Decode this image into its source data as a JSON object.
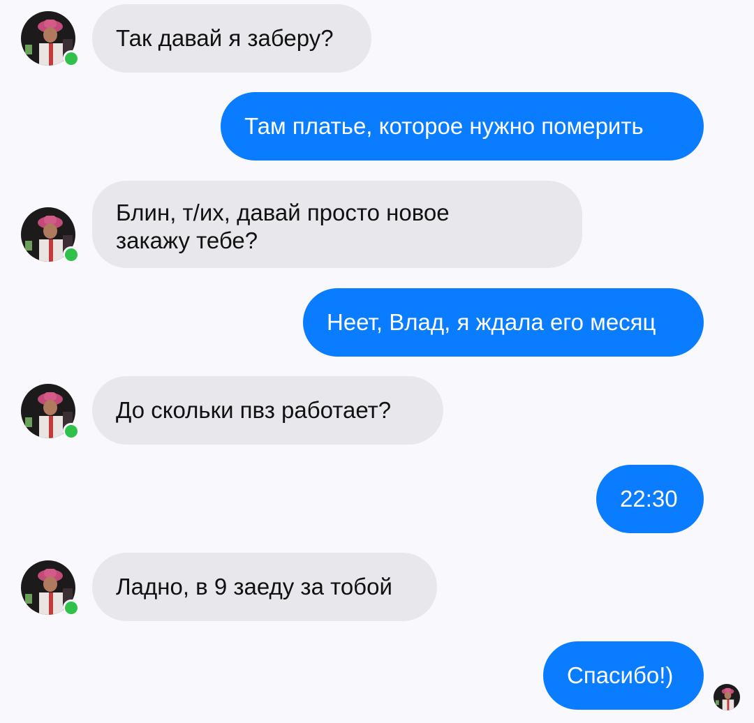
{
  "messages": [
    {
      "direction": "incoming",
      "text": "Так давай я заберу?"
    },
    {
      "direction": "outgoing",
      "text": "Там платье, которое нужно померить"
    },
    {
      "direction": "incoming",
      "text": "Блин, т/их, давай просто новое\nзакажу тебе?"
    },
    {
      "direction": "outgoing",
      "text": "Неет, Влад, я ждала его месяц"
    },
    {
      "direction": "incoming",
      "text": "До скольки пвз работает?"
    },
    {
      "direction": "outgoing",
      "text": "22:30"
    },
    {
      "direction": "incoming",
      "text": "Ладно, в 9 заеду за тобой"
    },
    {
      "direction": "outgoing",
      "text": "Спасибо!)"
    }
  ],
  "contact": {
    "avatar_icon": "contact-avatar-icon",
    "status": "online",
    "status_color": "#2fc14a"
  },
  "colors": {
    "incoming_bubble": "#e8e7ec",
    "outgoing_bubble": "#0a7cff",
    "background": "#f9f8fc"
  }
}
